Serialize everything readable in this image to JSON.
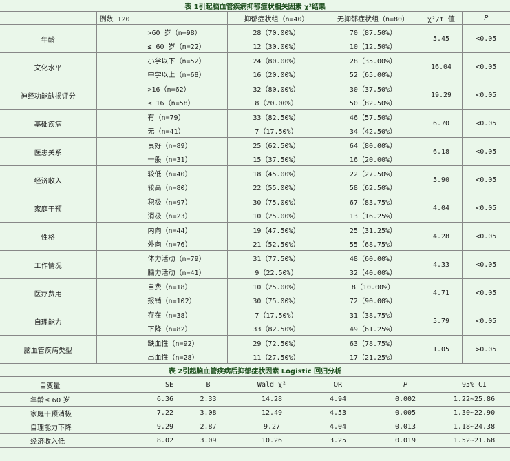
{
  "table1": {
    "caption": "表 1引起脑血管疾病抑郁症状相关因素 χ²结果",
    "headers": [
      "",
      "例数 120",
      "抑郁症状组（n=40）",
      "无抑郁症状组（n=80）",
      "χ²/t 值",
      "P"
    ],
    "groups": [
      {
        "factor": "年龄",
        "chi": "5.45",
        "p": "<0.05",
        "rows": [
          {
            "level": ">60 岁（n=98）",
            "dep": "28（70.00%）",
            "nodep": "70（87.50%）"
          },
          {
            "level": "≤ 60 岁（n=22）",
            "dep": "12（30.00%）",
            "nodep": "10（12.50%）"
          }
        ]
      },
      {
        "factor": "文化水平",
        "chi": "16.04",
        "p": "<0.05",
        "rows": [
          {
            "level": "小学以下（n=52）",
            "dep": "24（80.00%）",
            "nodep": "28（35.00%）"
          },
          {
            "level": "中学以上（n=68）",
            "dep": "16（20.00%）",
            "nodep": "52（65.00%）"
          }
        ]
      },
      {
        "factor": "神经功能缺损评分",
        "chi": "19.29",
        "p": "<0.05",
        "rows": [
          {
            "level": ">16（n=62）",
            "dep": "32（80.00%）",
            "nodep": "30（37.50%）"
          },
          {
            "level": "≤ 16（n=58）",
            "dep": "8（20.00%）",
            "nodep": "50（82.50%）"
          }
        ]
      },
      {
        "factor": "基础疾病",
        "chi": "6.70",
        "p": "<0.05",
        "rows": [
          {
            "level": "有（n=79）",
            "dep": "33（82.50%）",
            "nodep": "46（57.50%）"
          },
          {
            "level": "无（n=41）",
            "dep": "7（17.50%）",
            "nodep": "34（42.50%）"
          }
        ]
      },
      {
        "factor": "医患关系",
        "chi": "6.18",
        "p": "<0.05",
        "rows": [
          {
            "level": "良好（n=89）",
            "dep": "25（62.50%）",
            "nodep": "64（80.00%）"
          },
          {
            "level": "一般（n=31）",
            "dep": "15（37.50%）",
            "nodep": "16（20.00%）"
          }
        ]
      },
      {
        "factor": "经济收入",
        "chi": "5.90",
        "p": "<0.05",
        "rows": [
          {
            "level": "较低（n=40）",
            "dep": "18（45.00%）",
            "nodep": "22（27.50%）"
          },
          {
            "level": "较高（n=80）",
            "dep": "22（55.00%）",
            "nodep": "58（62.50%）"
          }
        ]
      },
      {
        "factor": "家庭干预",
        "chi": "4.04",
        "p": "<0.05",
        "rows": [
          {
            "level": "积极（n=97）",
            "dep": "30（75.00%）",
            "nodep": "67（83.75%）"
          },
          {
            "level": "消极（n=23）",
            "dep": "10（25.00%）",
            "nodep": "13（16.25%）"
          }
        ]
      },
      {
        "factor": "性格",
        "chi": "4.28",
        "p": "<0.05",
        "rows": [
          {
            "level": "内向（n=44）",
            "dep": "19（47.50%）",
            "nodep": "25（31.25%）"
          },
          {
            "level": "外向（n=76）",
            "dep": "21（52.50%）",
            "nodep": "55（68.75%）"
          }
        ]
      },
      {
        "factor": "工作情况",
        "chi": "4.33",
        "p": "<0.05",
        "rows": [
          {
            "level": "体力活动（n=79）",
            "dep": "31（77.50%）",
            "nodep": "48（60.00%）"
          },
          {
            "level": "脑力活动（n=41）",
            "dep": "9（22.50%）",
            "nodep": "32（40.00%）"
          }
        ]
      },
      {
        "factor": "医疗费用",
        "chi": "4.71",
        "p": "<0.05",
        "rows": [
          {
            "level": "自费（n=18）",
            "dep": "10（25.00%）",
            "nodep": "8（10.00%）"
          },
          {
            "level": "报销（n=102）",
            "dep": "30（75.00%）",
            "nodep": "72（90.00%）"
          }
        ]
      },
      {
        "factor": "自理能力",
        "chi": "5.79",
        "p": "<0.05",
        "rows": [
          {
            "level": "存在（n=38）",
            "dep": "7（17.50%）",
            "nodep": "31（38.75%）"
          },
          {
            "level": "下降（n=82）",
            "dep": "33（82.50%）",
            "nodep": "49（61.25%）"
          }
        ]
      },
      {
        "factor": "脑血管疾病类型",
        "chi": "1.05",
        "p": ">0.05",
        "rows": [
          {
            "level": "缺血性（n=92）",
            "dep": "29（72.50%）",
            "nodep": "63（78.75%）"
          },
          {
            "level": "出血性（n=28）",
            "dep": "11（27.50%）",
            "nodep": "17（21.25%）"
          }
        ]
      }
    ]
  },
  "table2": {
    "caption": "表 2引起脑血管疾病后抑郁症状因素 Logistic 回归分析",
    "headers": [
      "自变量",
      "SE",
      "B",
      "Wald χ²",
      "OR",
      "P",
      "95% CI"
    ],
    "rows": [
      [
        "年龄≤ 60 岁",
        "6.36",
        "2.33",
        "14.28",
        "4.94",
        "0.002",
        "1.22~25.86"
      ],
      [
        "家庭干预消极",
        "7.22",
        "3.08",
        "12.49",
        "4.53",
        "0.005",
        "1.30~22.90"
      ],
      [
        "自理能力下降",
        "9.29",
        "2.87",
        "9.27",
        "4.04",
        "0.013",
        "1.18~24.38"
      ],
      [
        "经济收入低",
        "8.02",
        "3.09",
        "10.26",
        "3.25",
        "0.019",
        "1.52~21.68"
      ]
    ]
  }
}
